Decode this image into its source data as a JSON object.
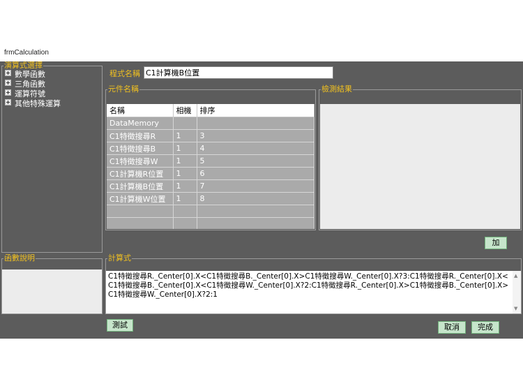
{
  "window": {
    "title": "frmCalculation"
  },
  "function_panel": {
    "legend": "演算式選擇",
    "items": [
      {
        "label": "數學函數"
      },
      {
        "label": "三角函數"
      },
      {
        "label": "運算符號"
      },
      {
        "label": "其他特殊運算"
      }
    ]
  },
  "description_panel": {
    "legend": "函數說明"
  },
  "program": {
    "label": "程式名稱",
    "value": "C1計算機B位置"
  },
  "components": {
    "legend": "元件名稱",
    "headers": [
      "名稱",
      "相機",
      "排序"
    ],
    "rows": [
      {
        "name": "DataMemory",
        "camera": "",
        "order": ""
      },
      {
        "name": "C1特徵搜尋R",
        "camera": "1",
        "order": "3"
      },
      {
        "name": "C1特徵搜尋B",
        "camera": "1",
        "order": "4"
      },
      {
        "name": "C1特徵搜尋W",
        "camera": "1",
        "order": "5"
      },
      {
        "name": "C1計算機R位置",
        "camera": "1",
        "order": "6"
      },
      {
        "name": "C1計算機B位置",
        "camera": "1",
        "order": "7"
      },
      {
        "name": "C1計算機W位置",
        "camera": "1",
        "order": "8"
      },
      {
        "name": "",
        "camera": "",
        "order": ""
      },
      {
        "name": "",
        "camera": "",
        "order": ""
      },
      {
        "name": "",
        "camera": "",
        "order": ""
      }
    ]
  },
  "detection": {
    "legend": "檢測結果"
  },
  "formula": {
    "legend": "計算式",
    "value": "C1特徵搜尋R._Center[0].X<C1特徵搜尋B._Center[0].X>C1特徵搜尋W._Center[0].X?3:C1特徵搜尋R._Center[0].X<C1特徵搜尋B._Center[0].X<C1特徵搜尋W._Center[0].X?2:C1特徵搜尋R._Center[0].X>C1特徵搜尋B._Center[0].X>C1特徵搜尋W._Center[0].X?2:1"
  },
  "buttons": {
    "add": "加",
    "test": "測試",
    "cancel": "取消",
    "done": "完成"
  },
  "icons": {
    "expand": "plus-box-icon",
    "scroll_up": "chevron-up-icon",
    "scroll_down": "chevron-down-icon"
  }
}
